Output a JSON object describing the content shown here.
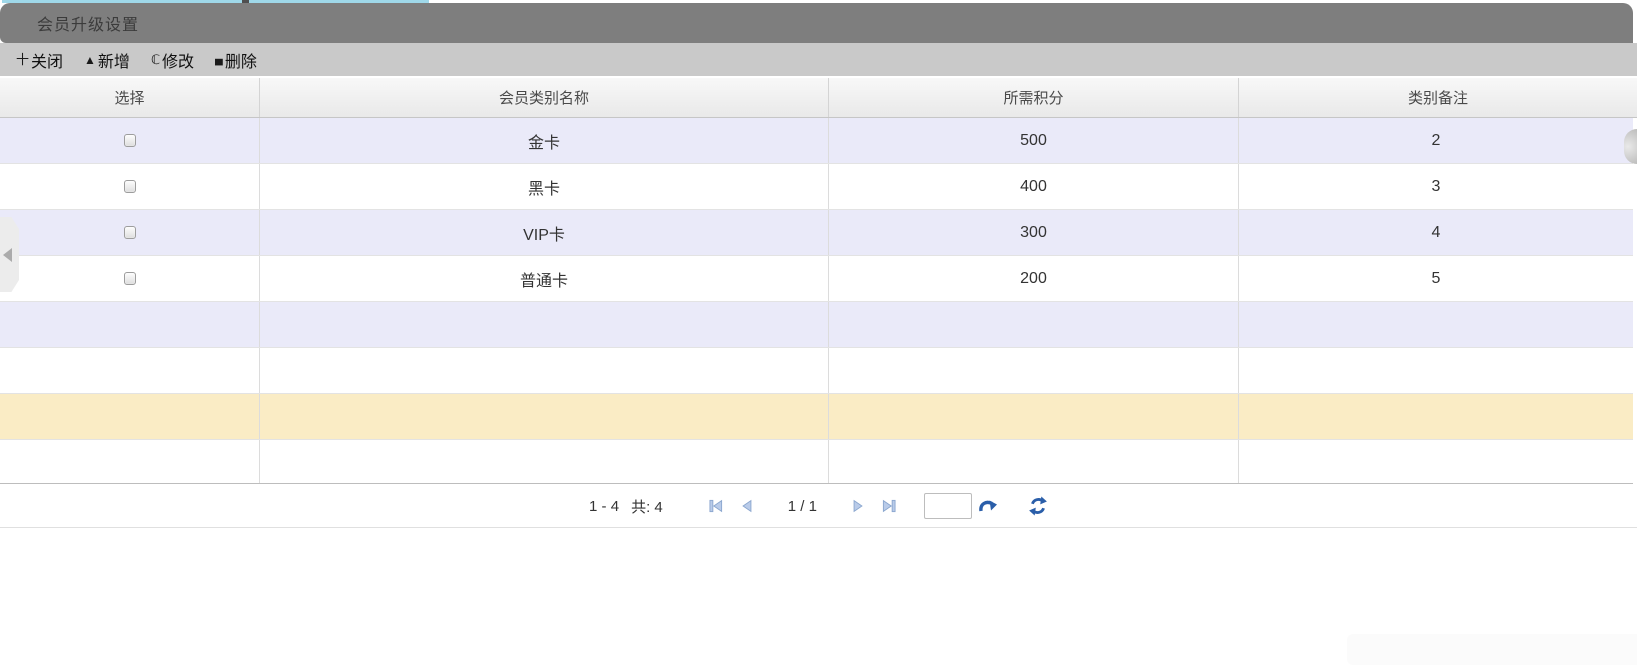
{
  "window": {
    "title": "会员升级设置"
  },
  "toolbar": {
    "buttons": [
      {
        "name": "close",
        "glyph": "十",
        "label": "关闭"
      },
      {
        "name": "add",
        "glyph": "▲",
        "label": "新增"
      },
      {
        "name": "edit",
        "glyph": "ℂ",
        "label": "修改"
      },
      {
        "name": "delete",
        "glyph": "▄",
        "label": "删除"
      }
    ]
  },
  "grid": {
    "columns": [
      "选择",
      "会员类别名称",
      "所需积分",
      "类别备注"
    ],
    "rows": [
      {
        "name": "金卡",
        "points": "500",
        "note": "2"
      },
      {
        "name": "黑卡",
        "points": "400",
        "note": "3"
      },
      {
        "name": "VIP卡",
        "points": "300",
        "note": "4"
      },
      {
        "name": "普通卡",
        "points": "200",
        "note": "5"
      }
    ],
    "empty_row_count": 4
  },
  "pager": {
    "range_label": "1 - 4",
    "total_label": "共: 4",
    "page_label": "1 / 1",
    "page_input_value": ""
  },
  "colors": {
    "titlebar_bg": "#7e7e7e",
    "tab_accent_cyan": "#9fd8e9",
    "toolbar_bg": "#c9c9c9",
    "row_alt_bg": "#eaeaf9",
    "row_highlight_bg": "#faecc5",
    "pager_icon_fill": "#b9cbe9",
    "pager_icon_stroke": "#8aa6ce",
    "action_icon_blue": "#2a5ea9"
  }
}
